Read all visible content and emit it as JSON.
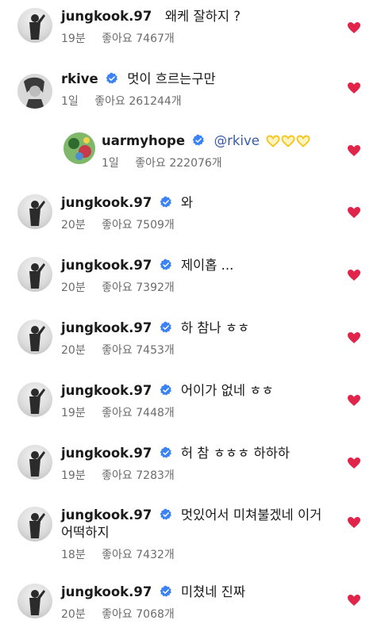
{
  "colors": {
    "like_heart": "#e0244a",
    "verified_badge": "#3b82f6",
    "mention": "#3a5aa8",
    "yellow_heart": "#f5c518",
    "meta_text": "#6b6b6b"
  },
  "likes_label": "좋아요",
  "comments": [
    {
      "username": "jungkook.97",
      "verified": false,
      "text": "왜케 잘하지 ?",
      "time": "19분",
      "likes": "7467개",
      "liked": true
    },
    {
      "username": "rkive",
      "verified": true,
      "text": "멋이 흐르는구만",
      "time": "1일",
      "likes": "261244개",
      "liked": true
    },
    {
      "username": "uarmyhope",
      "verified": true,
      "mention": "@rkive",
      "hearts_icon": "yellow-heart-outline-icon",
      "hearts_count": 3,
      "time": "1일",
      "likes": "222076개",
      "liked": true,
      "reply": true
    },
    {
      "username": "jungkook.97",
      "verified": true,
      "text": "와",
      "time": "20분",
      "likes": "7509개",
      "liked": true
    },
    {
      "username": "jungkook.97",
      "verified": true,
      "text": "제이홉 ...",
      "time": "20분",
      "likes": "7392개",
      "liked": true
    },
    {
      "username": "jungkook.97",
      "verified": true,
      "text": "하 참나 ㅎㅎ",
      "time": "20분",
      "likes": "7453개",
      "liked": true
    },
    {
      "username": "jungkook.97",
      "verified": true,
      "text": "어이가 없네 ㅎㅎ",
      "time": "19분",
      "likes": "7448개",
      "liked": true
    },
    {
      "username": "jungkook.97",
      "verified": true,
      "text": "허 참 ㅎㅎㅎ 하하하",
      "time": "19분",
      "likes": "7283개",
      "liked": true
    },
    {
      "username": "jungkook.97",
      "verified": true,
      "text": "멋있어서 미쳐불겠네 이거",
      "text_line2": "어떡하지",
      "time": "18분",
      "likes": "7432개",
      "liked": true
    },
    {
      "username": "jungkook.97",
      "verified": true,
      "text": "미쳤네 진짜",
      "time": "20분",
      "likes": "7068개",
      "liked": true
    }
  ]
}
